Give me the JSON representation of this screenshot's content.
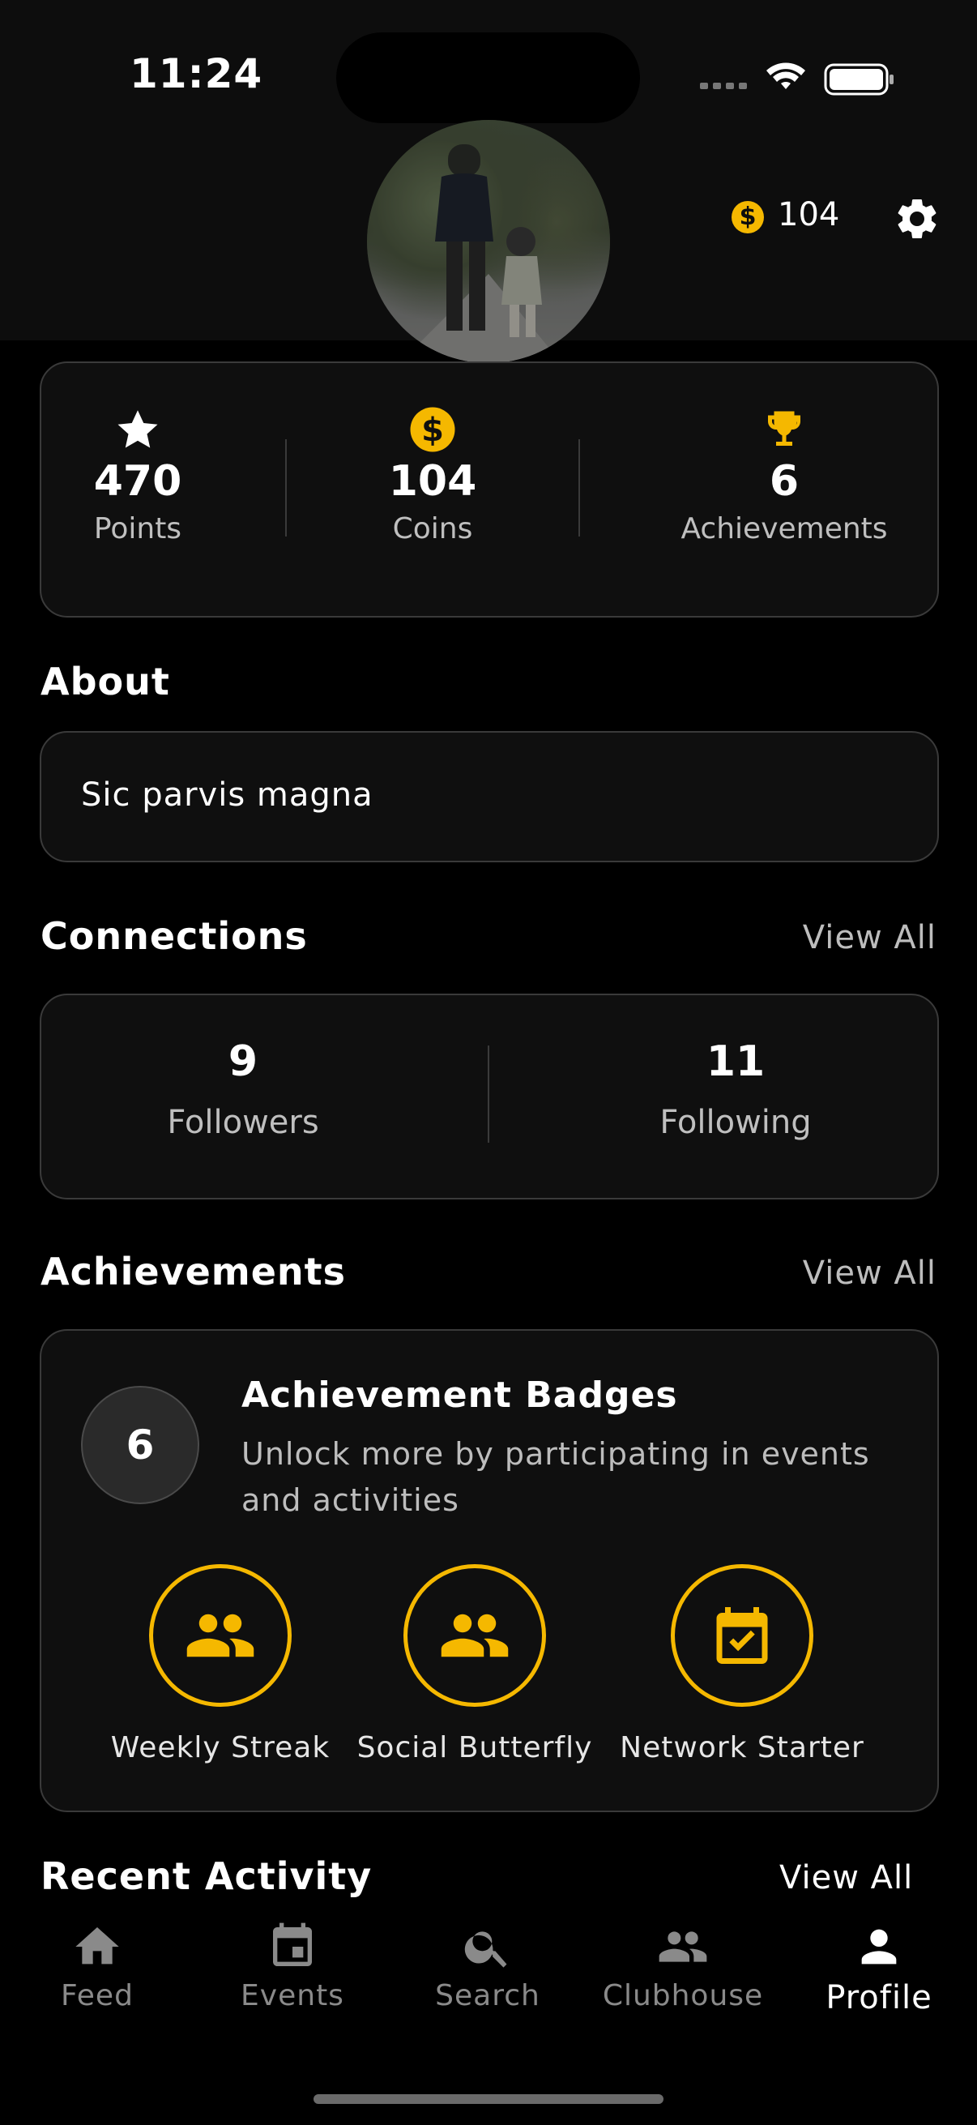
{
  "status_bar": {
    "time": "11:24"
  },
  "header": {
    "coin_balance": "104"
  },
  "stats": [
    {
      "icon": "star-icon",
      "value": "470",
      "label": "Points"
    },
    {
      "icon": "coin-icon",
      "value": "104",
      "label": "Coins"
    },
    {
      "icon": "trophy-icon",
      "value": "6",
      "label": "Achievements"
    }
  ],
  "about": {
    "title": "About",
    "text": "Sic parvis magna"
  },
  "connections": {
    "title": "Connections",
    "view_all": "View All",
    "followers": {
      "value": "9",
      "label": "Followers"
    },
    "following": {
      "value": "11",
      "label": "Following"
    }
  },
  "achievements": {
    "title": "Achievements",
    "view_all": "View All",
    "count": "6",
    "card_title": "Achievement Badges",
    "card_subtitle": "Unlock more by participating in events and activities",
    "badges": [
      {
        "icon": "group-icon",
        "label": "Weekly Streak"
      },
      {
        "icon": "group-icon",
        "label": "Social Butterfly"
      },
      {
        "icon": "calendar-check-icon",
        "label": "Network Starter"
      }
    ]
  },
  "recent_activity": {
    "title": "Recent Activity",
    "view_all": "View All"
  },
  "nav": [
    {
      "icon": "home-icon",
      "label": "Feed"
    },
    {
      "icon": "calendar-icon",
      "label": "Events"
    },
    {
      "icon": "search-icon",
      "label": "Search"
    },
    {
      "icon": "people-icon",
      "label": "Clubhouse"
    },
    {
      "icon": "person-icon",
      "label": "Profile",
      "active": true
    }
  ],
  "colors": {
    "accent": "#f5b800",
    "background": "#000000",
    "card": "#0f0f0f",
    "border": "#3a3a3a"
  }
}
